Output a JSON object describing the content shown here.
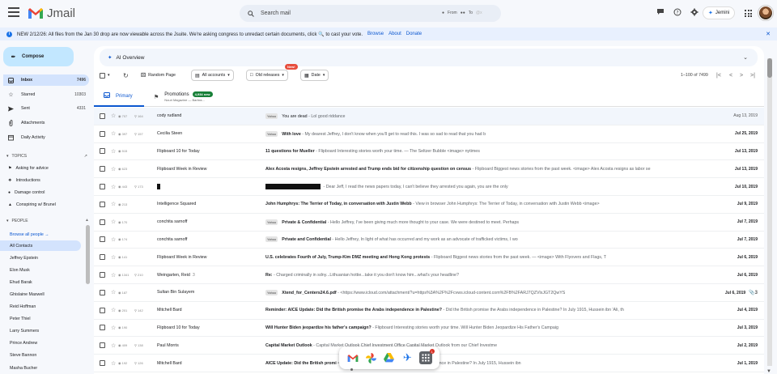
{
  "app": {
    "name": "Jmail"
  },
  "search": {
    "placeholder": "Search mail",
    "from_label": "From",
    "to_label": "To",
    "to_hint": "@x"
  },
  "top_icons": [
    "chat-icon",
    "help-icon",
    "settings-icon"
  ],
  "jemini_label": "Jemini",
  "banner": {
    "text": "NEW 2/12/26: All files from the Jan 30 drop are now viewable across the Jsuite. We're asking congress to unredact certain documents, click 🔍 to cast your vote.",
    "links": [
      "Browse",
      "About",
      "Donate"
    ]
  },
  "sidebar": {
    "compose_label": "Compose",
    "items": [
      {
        "label": "Inbox",
        "count": "7496",
        "icon": "inbox-icon"
      },
      {
        "label": "Starred",
        "count": "10303",
        "icon": "star-icon"
      },
      {
        "label": "Sent",
        "count": "4331",
        "icon": "send-icon"
      },
      {
        "label": "Attachments",
        "count": "",
        "icon": "paperclip-icon"
      },
      {
        "label": "Daily Activity",
        "count": "",
        "icon": "calendar-icon"
      }
    ],
    "topics_header": "TOPICS",
    "topics": [
      {
        "label": "Asking for advice",
        "icon": "tag-icon"
      },
      {
        "label": "Introductions",
        "icon": "tag-icon"
      },
      {
        "label": "Damage control",
        "icon": "tag-icon"
      },
      {
        "label": "Conspiring w/ Brunel",
        "icon": "tag-icon"
      }
    ],
    "people_header": "PEOPLE",
    "browse_people": "Browse all people →",
    "people": [
      "All Contacts",
      "Jeffrey Epstein",
      "Elon Musk",
      "Ehud Barak",
      "Ghislaine Maxwell",
      "Reid Hoffman",
      "Peter Thiel",
      "Larry Summers",
      "Prince Andrew",
      "Steve Bannon",
      "Masha Bucher"
    ]
  },
  "main": {
    "ai_overview_label": "AI Overview",
    "toolbar": {
      "random_page": "Random Page",
      "all_accounts": "All accounts",
      "old_releases": "Old releases",
      "new_badge": "New!",
      "date": "Date",
      "pager": "1–100 of 7499"
    },
    "tabs": {
      "primary": "Primary",
      "promotions": "Promotions",
      "promotions_badge": "4,934 new",
      "promotions_sub": "Nouri Magazine — Barbra..."
    },
    "emails": [
      {
        "read": true,
        "views": "707",
        "zoom": "164",
        "sender": "cody rudland",
        "sender_count": "",
        "tag": "Yahoo",
        "subject": "You are dead",
        "snippet": " - Lol good riddance",
        "date": "Aug 13, 2019",
        "redacted_sender": false,
        "redacted_subject": false,
        "attach": ""
      },
      {
        "read": false,
        "views": "397",
        "zoom": "157",
        "sender": "Cecilia Steen",
        "sender_count": "",
        "tag": "Yahoo",
        "subject": "With love",
        "snippet": " - My dearest Jeffrey, I don't know when you'll get to read this. I was so sad to read that you had b",
        "date": "Jul 25, 2019",
        "redacted_sender": false,
        "redacted_subject": false,
        "attach": ""
      },
      {
        "read": false,
        "views": "515",
        "zoom": "",
        "sender": "Flipboard 10 for Today",
        "sender_count": "",
        "tag": "",
        "subject": "11 questions for Mueller",
        "snippet": " - Flipboard Interesting stories worth your time. — The Seltzer Bubble <image> nytimes",
        "date": "Jul 13, 2019",
        "redacted_sender": false,
        "redacted_subject": false,
        "attach": ""
      },
      {
        "read": false,
        "views": "623",
        "zoom": "",
        "sender": "Flipboard Week in Review",
        "sender_count": "",
        "tag": "",
        "subject": "Alex Acosta resigns, Jeffrey Epstein arrested and Trump ends bid for citizenship question on census",
        "snippet": " - Flipboard Biggest news stories from the past week. <image> Alex Acosta resigns as labor se",
        "date": "Jul 13, 2019",
        "redacted_sender": false,
        "redacted_subject": false,
        "attach": ""
      },
      {
        "read": false,
        "views": "443",
        "zoom": "173",
        "sender": "",
        "sender_count": "",
        "tag": "",
        "subject": "",
        "snippet": " - Dear Jeff, I read the news papers today, I can't believe they arrested you again, you are the only",
        "date": "Jul 10, 2019",
        "redacted_sender": true,
        "redacted_subject": true,
        "attach": ""
      },
      {
        "read": false,
        "views": "213",
        "zoom": "",
        "sender": "Intelligence Squared",
        "sender_count": "",
        "tag": "",
        "subject": "John Humphrys: The Terrier of Today, in conversation with Justin Webb",
        "snippet": " - View in browser John Humphrys: The Terrier of Today, in conversation with Justin Webb <image>",
        "date": "Jul 9, 2019",
        "redacted_sender": false,
        "redacted_subject": false,
        "attach": ""
      },
      {
        "read": false,
        "views": "170",
        "zoom": "",
        "sender": "conchita sarnoff",
        "sender_count": "",
        "tag": "Yahoo",
        "subject": "Private & Confidential",
        "snippet": " - Hello Jeffrey, I've been giving much more thought to your case. We were destined to meet. Perhaps",
        "date": "Jul 7, 2019",
        "redacted_sender": false,
        "redacted_subject": false,
        "attach": ""
      },
      {
        "read": false,
        "views": "174",
        "zoom": "",
        "sender": "conchita sarnoff",
        "sender_count": "",
        "tag": "Yahoo",
        "subject": "Private and Confidential",
        "snippet": " - Hello Jeffrey, In light of what has occurred and my work as an advocate of trafficked victims, I wo",
        "date": "Jul 7, 2019",
        "redacted_sender": false,
        "redacted_subject": false,
        "attach": ""
      },
      {
        "read": false,
        "views": "141",
        "zoom": "",
        "sender": "Flipboard Week in Review",
        "sender_count": "",
        "tag": "",
        "subject": "U.S. celebrates Fourth of July, Trump-Kim DMZ meeting and Hong Kong protests",
        "snippet": " - Flipboard Biggest news stories from the past week. — <image> With Flyovers and Flags, T",
        "date": "Jul 6, 2019",
        "redacted_sender": false,
        "redacted_subject": false,
        "attach": ""
      },
      {
        "read": false,
        "views": "1341",
        "zoom": "210",
        "sender": "Weingarten, Reid",
        "sender_count": "3",
        "tag": "",
        "subject": "Re:",
        "snippet": " - Charged criminally in sdny...Lithuanian hottie...take it you don't know him...what's your headline?",
        "date": "Jul 6, 2019",
        "redacted_sender": false,
        "redacted_subject": false,
        "attach": ""
      },
      {
        "read": false,
        "views": "187",
        "zoom": "",
        "sender": "Sultan Bin Sulayem",
        "sender_count": "",
        "tag": "Yahoo",
        "subject": "Xtend_for_Centers24.6.pdf",
        "snippet": " - <https://www.icloud.com/attachment/?u=https%3A%2F%2Fcvws.icloud-content.com%2FB%2FARJ7QZVlxJGT2QwYS",
        "date": "Jul 6, 2019",
        "redacted_sender": false,
        "redacted_subject": false,
        "attach": "3"
      },
      {
        "read": false,
        "views": "201",
        "zoom": "142",
        "sender": "Mitchell Bard",
        "sender_count": "",
        "tag": "",
        "subject": "Reminder: AICE Update: Did the British promise the Arabs independence in Palestine?",
        "snippet": " - Did the British promise the Arabs independence in Palestine? In July 1915, Hussein ibn 'Ali, th",
        "date": "Jul 4, 2019",
        "redacted_sender": false,
        "redacted_subject": false,
        "attach": ""
      },
      {
        "read": false,
        "views": "190",
        "zoom": "",
        "sender": "Flipboard 10 for Today",
        "sender_count": "",
        "tag": "",
        "subject": "Will Hunter Biden jeopardize his father's campaign?",
        "snippet": " - Flipboard Interesting stories worth your time. Will Hunter Biden Jeopardize His Father's Campaig",
        "date": "Jul 3, 2019",
        "redacted_sender": false,
        "redacted_subject": false,
        "attach": ""
      },
      {
        "read": false,
        "views": "409",
        "zoom": "138",
        "sender": "Paul Morris",
        "sender_count": "",
        "tag": "",
        "subject": "Capital Market Outlook",
        "snippet": " - Capital Market Outlook Chief Investment Office Capital Market Outlook from our Chief Investme",
        "date": "Jul 2, 2019",
        "redacted_sender": false,
        "redacted_subject": false,
        "attach": ""
      },
      {
        "read": false,
        "views": "192",
        "zoom": "126",
        "sender": "Mitchell Bard",
        "sender_count": "",
        "tag": "",
        "subject": "AICE Update: Did the British promi",
        "snippet": " <image> Did the British promise the Arabs independence in Palestine? In July 1915, Hussein ibn",
        "date": "Jul 1, 2019",
        "redacted_sender": false,
        "redacted_subject": false,
        "attach": ""
      }
    ]
  },
  "dock": {
    "apps": [
      "jmail-app-icon",
      "photos-app-icon",
      "drive-app-icon",
      "flights-app-icon",
      "apps-grid-icon"
    ],
    "badge": "1"
  },
  "colors": {
    "accent": "#0b57d0",
    "compose_bg": "#c2e7ff",
    "active_nav": "#d3e3fd",
    "banner_bg": "#e8f0fe",
    "promo_badge": "#188038"
  }
}
